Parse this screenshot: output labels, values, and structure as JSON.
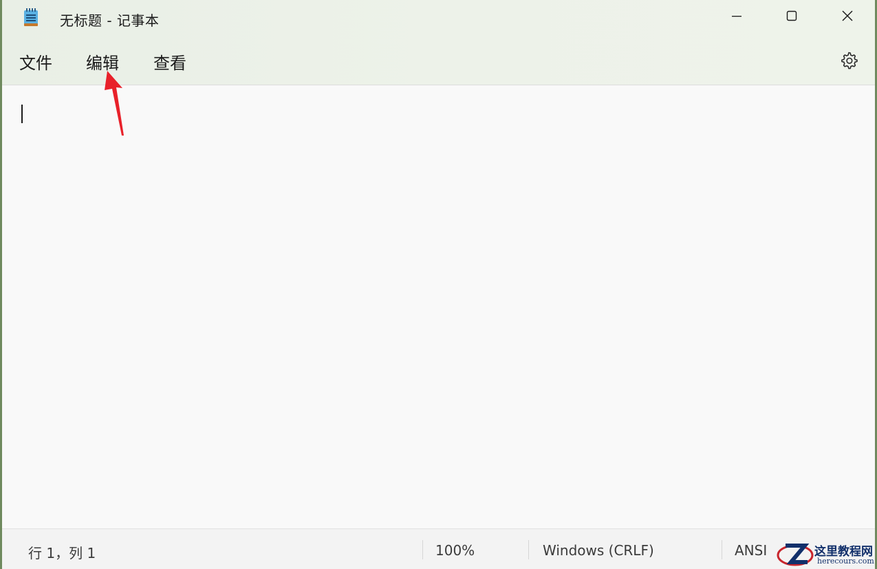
{
  "window": {
    "title": "无标题 - 记事本",
    "accent_color": "#eaf0e7"
  },
  "icons": {
    "app": "notepad-icon",
    "minimize": "minimize-icon",
    "maximize": "maximize-icon",
    "close": "close-icon",
    "settings": "gear-icon"
  },
  "menu": {
    "items": [
      {
        "label": "文件"
      },
      {
        "label": "编辑"
      },
      {
        "label": "查看"
      }
    ]
  },
  "editor": {
    "content": ""
  },
  "status": {
    "position": "行 1，列 1",
    "zoom": "100%",
    "line_ending": "Windows (CRLF)",
    "encoding": "ANSI"
  },
  "watermark": {
    "title": "这里教程网",
    "url": "herecours.com"
  },
  "annotation": {
    "arrow_color": "#e8212a"
  }
}
